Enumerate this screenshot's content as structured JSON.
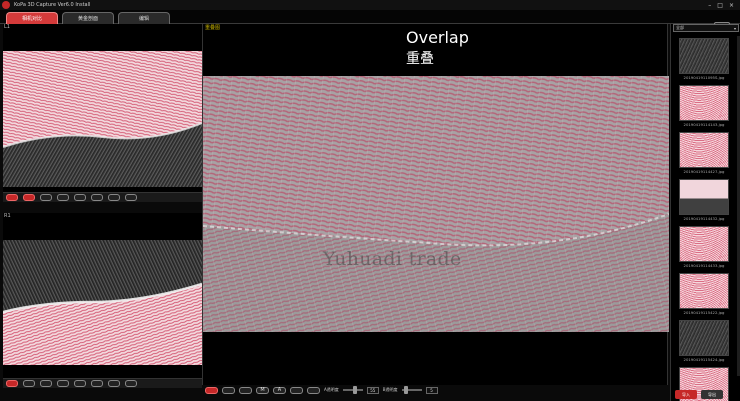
{
  "window": {
    "title": "KoPa 3D Capture Ver6.0 Install",
    "controls": [
      "–",
      "□",
      "×"
    ]
  },
  "tabs": [
    {
      "label": "相机对比",
      "active": true
    },
    {
      "label": "黄金剖面",
      "active": false
    },
    {
      "label": "编辑",
      "active": false
    }
  ],
  "left_panels": {
    "top_label": "L1",
    "bottom_label": "R1"
  },
  "center": {
    "label": "重叠图",
    "overlay_title_en": "Overlap",
    "overlay_title_zh": "重叠",
    "watermark": "Yuhuadi trade"
  },
  "bottom_toolbar": {
    "buttons": [
      "M",
      "A"
    ],
    "opacity_label_1": "A透明度",
    "opacity_value_1": "55",
    "opacity_label_2": "B透明度",
    "opacity_value_2": "5"
  },
  "gallery": {
    "select_value": "全部",
    "thumbnails": [
      {
        "caption": "2019041911095S.jpg",
        "tone": "gray"
      },
      {
        "caption": "20190419114143.jpg",
        "tone": "pink"
      },
      {
        "caption": "20190419114427.jpg",
        "tone": "pink"
      },
      {
        "caption": "20190419114432.jpg",
        "tone": "pink-gray"
      },
      {
        "caption": "20190419114433.jpg",
        "tone": "pink"
      },
      {
        "caption": "20190419115422.jpg",
        "tone": "pink"
      },
      {
        "caption": "20190419115424.jpg",
        "tone": "gray"
      },
      {
        "caption": "20190419115425.jpg",
        "tone": "pink"
      }
    ],
    "bottom_buttons": [
      "导入",
      "导出"
    ]
  },
  "colors": {
    "accent": "#c62828",
    "tab_active": "#d43a3a",
    "background": "#000000"
  }
}
